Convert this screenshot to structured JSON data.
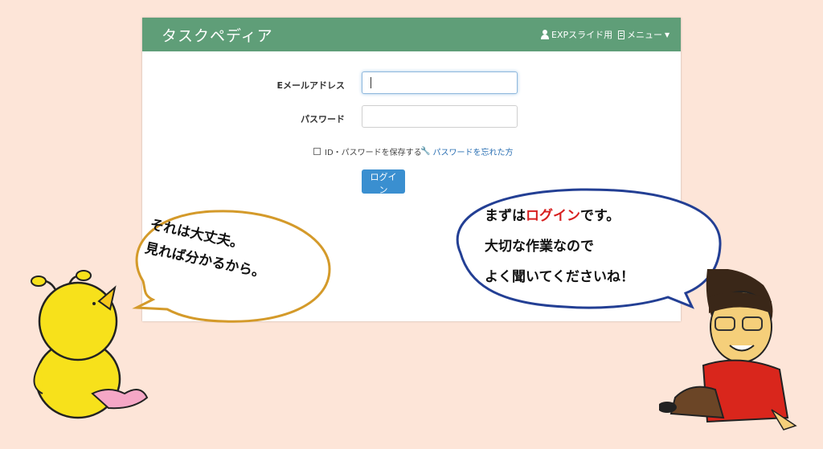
{
  "app": {
    "brand": "タスクペディア",
    "nav_user_label": "EXPスライド用",
    "nav_menu_label": "メニュー",
    "user_icon": "user-icon",
    "menu_icon": "menu-icon"
  },
  "login_form": {
    "email_label": "Eメールアドレス",
    "email_value": "",
    "password_label": "パスワード",
    "password_value": "",
    "remember_label": "ID・パスワードを保存する",
    "remember_checked": false,
    "forgot_label": "パスワードを忘れた方",
    "forgot_icon": "wrench-icon",
    "submit_label": "ログイン"
  },
  "bubbles": {
    "left_line1": "それは大丈夫。",
    "left_line2": "見れば分かるから。",
    "right_line1_part1": "まずは",
    "right_line1_highlight": "ログイン",
    "right_line1_part2": "です。",
    "right_line2": "大切な作業なので",
    "right_line3": "よく聞いてくださいね！"
  },
  "colors": {
    "page_background": "#fde5d8",
    "navbar": "#5f9e78",
    "button": "#3a8fd0",
    "link": "#2a6fb3",
    "left_bubble_border": "#d49a2a",
    "right_bubble_border": "#233f94",
    "highlight": "#d71f1f"
  }
}
